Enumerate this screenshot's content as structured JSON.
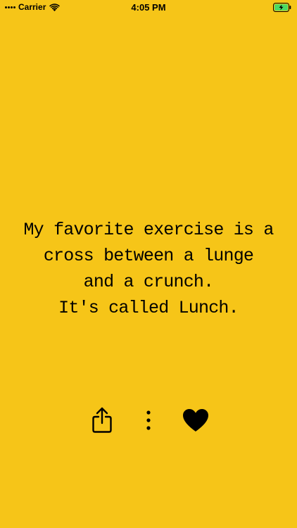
{
  "status_bar": {
    "carrier": "Carrier",
    "time": "4:05 PM"
  },
  "quote": {
    "lines": [
      "My favorite exercise is a",
      "cross between a lunge",
      "and a crunch.",
      "It's called Lunch."
    ]
  },
  "actions": {
    "share_icon": "share-icon",
    "more_icon": "more-vertical-icon",
    "like_icon": "heart-icon"
  },
  "colors": {
    "background": "#F6C518",
    "foreground": "#000000",
    "battery_fill": "#4CD964"
  }
}
